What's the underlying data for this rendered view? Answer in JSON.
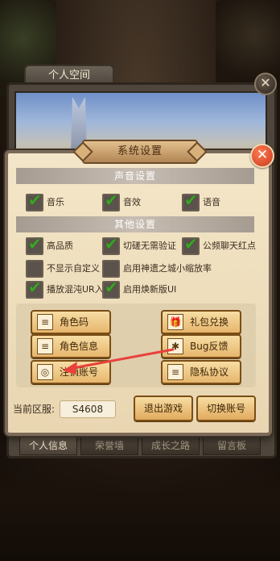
{
  "background": {
    "space_tab_label": "个人空间",
    "space_close": "✕",
    "bottom_tabs": [
      "个人信息",
      "荣誉墙",
      "成长之路",
      "留言板"
    ]
  },
  "dialog": {
    "title": "系统设置",
    "close": "✕",
    "sound_section": "声音设置",
    "other_section": "其他设置",
    "sound_options": [
      {
        "label": "音乐",
        "checked": true
      },
      {
        "label": "音效",
        "checked": true
      },
      {
        "label": "语音",
        "checked": true
      }
    ],
    "other_options": [
      {
        "label": "高品质",
        "checked": true
      },
      {
        "label": "切磋无需验证",
        "checked": true
      },
      {
        "label": "公频聊天红点",
        "checked": true
      },
      {
        "label": "不显示自定义",
        "checked": false
      },
      {
        "label": "启用神遗之城小缩放率",
        "checked": false
      },
      {
        "label": "播放混沌UR入",
        "checked": true
      },
      {
        "label": "启用焕新版UI",
        "checked": true
      }
    ],
    "buttons": {
      "role_code": "角色码",
      "gift_exchange": "礼包兑换",
      "role_info": "角色信息",
      "bug_feedback": "Bug反馈",
      "cancel_account": "注销账号",
      "privacy": "隐私协议"
    },
    "icons": {
      "role_code": "≡",
      "gift_exchange": "🎁",
      "role_info": "≡",
      "bug_feedback": "✱",
      "cancel_account": "◎",
      "privacy": "≡"
    },
    "server_label": "当前区服:",
    "server_value": "S4608",
    "exit_game": "退出游戏",
    "switch_account": "切换账号",
    "tick": "✔"
  },
  "colors": {
    "arrow": "#e8413c"
  }
}
